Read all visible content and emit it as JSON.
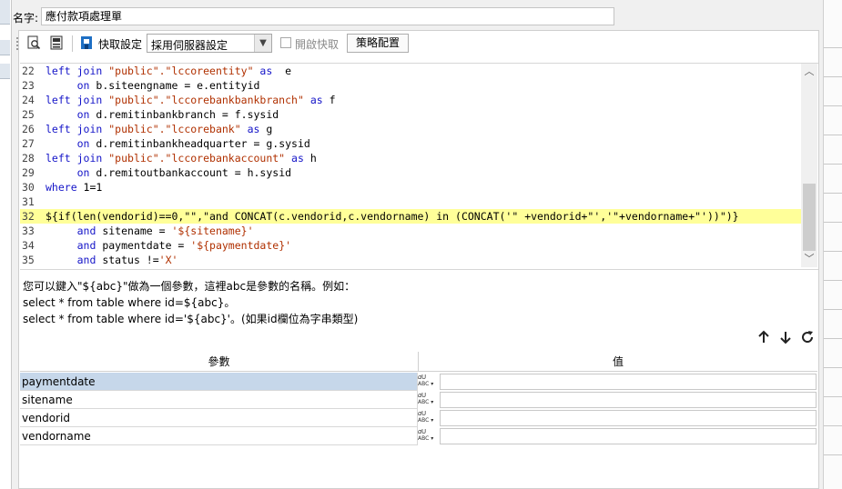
{
  "name_field": {
    "label": "名字:",
    "value": "應付款項處理單"
  },
  "toolbar": {
    "icons": [
      "preview-icon",
      "database-icon",
      "cache-flag-icon"
    ],
    "cache_label": "快取設定",
    "cache_select_value": "採用伺服器設定",
    "enable_cache_label": "開啟快取",
    "enable_cache_checked": false,
    "strategy_button": "策略配置"
  },
  "code": {
    "lines": [
      {
        "no": "22",
        "segments": [
          [
            "kw",
            "left join "
          ],
          [
            "st",
            "\"public\".\"lccoreentity\""
          ],
          [
            "kw",
            " as"
          ],
          [
            "",
            "  e"
          ]
        ]
      },
      {
        "no": "23",
        "segments": [
          [
            "",
            "     "
          ],
          [
            "kw",
            "on"
          ],
          [
            "",
            " b.siteengname = e.entityid"
          ]
        ]
      },
      {
        "no": "24",
        "segments": [
          [
            "kw",
            "left join "
          ],
          [
            "st",
            "\"public\".\"lccorebankbankbranch\""
          ],
          [
            "kw",
            " as"
          ],
          [
            "",
            " f"
          ]
        ]
      },
      {
        "no": "25",
        "segments": [
          [
            "",
            "     "
          ],
          [
            "kw",
            "on"
          ],
          [
            "",
            " d.remitinbankbranch = f.sysid"
          ]
        ]
      },
      {
        "no": "26",
        "segments": [
          [
            "kw",
            "left join "
          ],
          [
            "st",
            "\"public\".\"lccorebank\""
          ],
          [
            "kw",
            " as"
          ],
          [
            "",
            " g"
          ]
        ]
      },
      {
        "no": "27",
        "segments": [
          [
            "",
            "     "
          ],
          [
            "kw",
            "on"
          ],
          [
            "",
            " d.remitinbankheadquarter = g.sysid"
          ]
        ]
      },
      {
        "no": "28",
        "segments": [
          [
            "kw",
            "left join "
          ],
          [
            "st",
            "\"public\".\"lccorebankaccount\""
          ],
          [
            "kw",
            " as"
          ],
          [
            "",
            " h"
          ]
        ]
      },
      {
        "no": "29",
        "segments": [
          [
            "",
            "     "
          ],
          [
            "kw",
            "on"
          ],
          [
            "",
            " d.remitoutbankaccount = h.sysid"
          ]
        ]
      },
      {
        "no": "30",
        "segments": [
          [
            "kw",
            "where"
          ],
          [
            "",
            " 1=1"
          ]
        ]
      },
      {
        "no": "31",
        "segments": [
          [
            "",
            ""
          ]
        ]
      },
      {
        "no": "32",
        "highlight": true,
        "segments": [
          [
            "",
            "${if(len(vendorid)==0,\"\",\"and CONCAT(c.vendorid,c.vendorname) in (CONCAT('\" +vendorid+\"','\"+vendorname+\"'))\")}"
          ]
        ]
      },
      {
        "no": "33",
        "segments": [
          [
            "",
            "     "
          ],
          [
            "kw",
            "and"
          ],
          [
            "",
            " sitename = "
          ],
          [
            "st",
            "'${sitename}'"
          ]
        ]
      },
      {
        "no": "34",
        "segments": [
          [
            "",
            "     "
          ],
          [
            "kw",
            "and"
          ],
          [
            "",
            " paymentdate = "
          ],
          [
            "st",
            "'${paymentdate}'"
          ]
        ]
      },
      {
        "no": "35",
        "segments": [
          [
            "",
            "     "
          ],
          [
            "kw",
            "and"
          ],
          [
            "",
            " status !="
          ],
          [
            "st",
            "'X'"
          ]
        ]
      }
    ]
  },
  "help": {
    "line1": "您可以鍵入\"${abc}\"做為一個參數，這裡abc是參數的名稱。例如：",
    "line2": "select * from table where id=${abc}。",
    "line3": "select * from table where id='${abc}'。(如果id欄位為字串類型)"
  },
  "param_buttons": {
    "up": "🠕",
    "down": "🠗",
    "refresh": "↻"
  },
  "param_table": {
    "headers": [
      "參數",
      "值"
    ],
    "type_icon_text": "ABC",
    "rows": [
      {
        "name": "paymentdate",
        "value": "",
        "selected": true
      },
      {
        "name": "sitename",
        "value": "",
        "selected": false
      },
      {
        "name": "vendorid",
        "value": "",
        "selected": false
      },
      {
        "name": "vendorname",
        "value": "",
        "selected": false
      }
    ]
  },
  "colors": {
    "keyword": "#1414c8",
    "string": "#b03000",
    "highlight": "#ffff99",
    "selected_row": "#c6d7ea"
  }
}
